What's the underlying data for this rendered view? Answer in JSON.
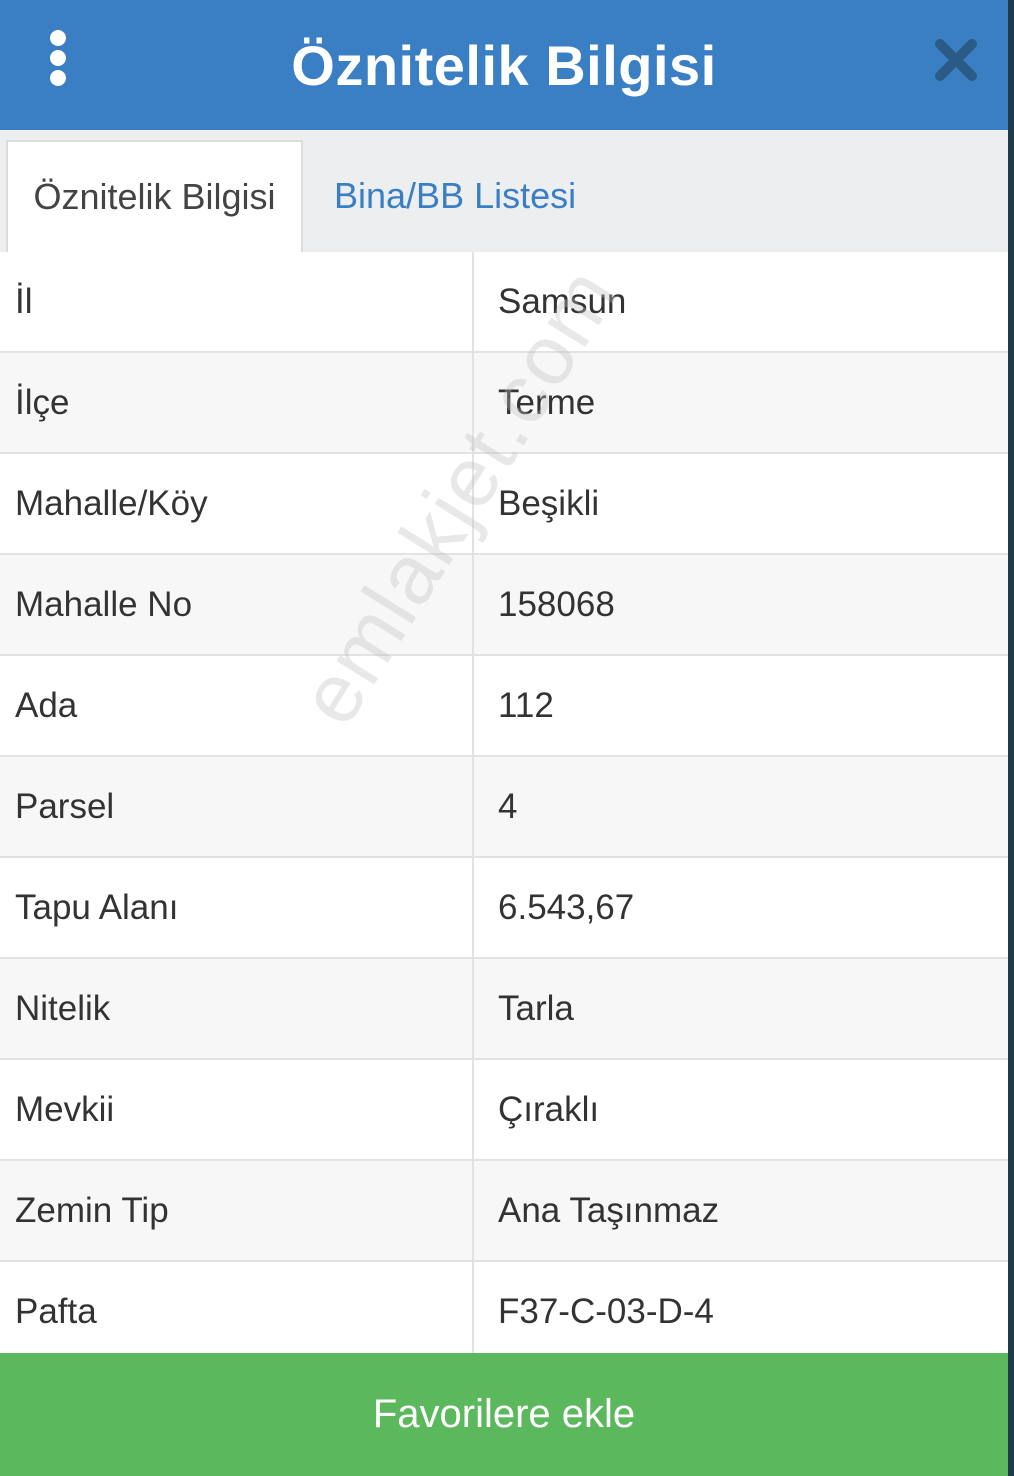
{
  "header": {
    "title": "Öznitelik Bilgisi",
    "menu_icon": "more-vertical-icon",
    "close_icon": "close-icon"
  },
  "tabs": [
    {
      "label": "Öznitelik Bilgisi",
      "active": true
    },
    {
      "label": "Bina/BB Listesi",
      "active": false
    }
  ],
  "rows": [
    {
      "label": "İl",
      "value": "Samsun"
    },
    {
      "label": "İlçe",
      "value": "Terme"
    },
    {
      "label": "Mahalle/Köy",
      "value": "Beşikli"
    },
    {
      "label": "Mahalle No",
      "value": "158068"
    },
    {
      "label": "Ada",
      "value": "112"
    },
    {
      "label": "Parsel",
      "value": "4"
    },
    {
      "label": "Tapu Alanı",
      "value": "6.543,67"
    },
    {
      "label": "Nitelik",
      "value": "Tarla"
    },
    {
      "label": "Mevkii",
      "value": "Çıraklı"
    },
    {
      "label": "Zemin Tip",
      "value": "Ana Taşınmaz"
    },
    {
      "label": "Pafta",
      "value": "F37-C-03-D-4"
    }
  ],
  "watermark": "emlakjet.com",
  "footer": {
    "favorite_label": "Favorilere ekle"
  },
  "colors": {
    "header_bg": "#3a7fc4",
    "tab_link": "#3a7fc4",
    "button_bg": "#5cb85c",
    "close_icon": "#2c5a86"
  }
}
